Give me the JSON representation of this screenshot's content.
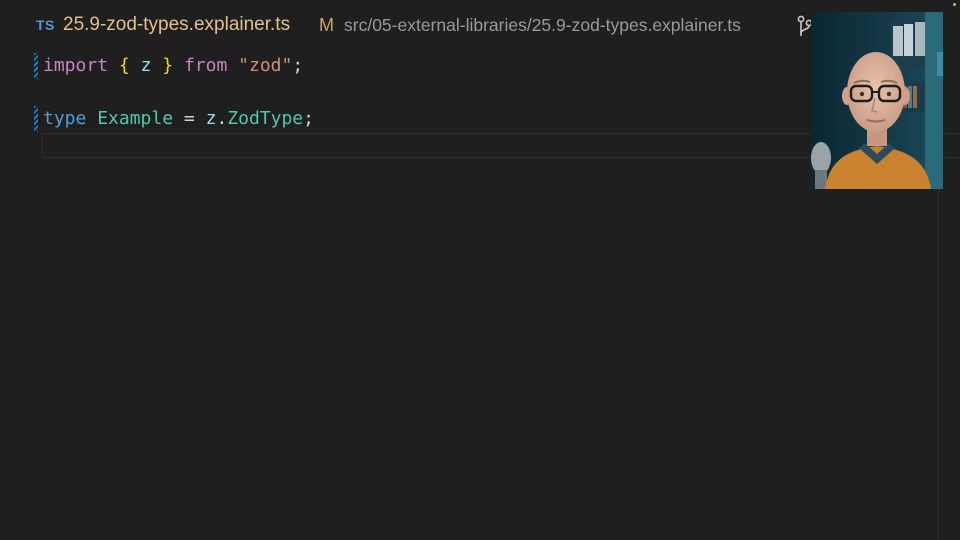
{
  "tab": {
    "language_badge": "TS",
    "file_name": "25.9-zod-types.explainer.ts",
    "status": "M",
    "file_path": "src/05-external-libraries/25.9-zod-types.explainer.ts"
  },
  "code": {
    "line1": {
      "kw": "import",
      "open_brace": "{",
      "ident": "z",
      "close_brace": "}",
      "from": "from",
      "module": "\"zod\"",
      "end": ";"
    },
    "line2": {
      "kw": "type",
      "name": "Example",
      "eq": "=",
      "ns": "z",
      "dot": ".",
      "type_ref": "ZodType",
      "end": ";"
    }
  },
  "colors": {
    "background": "#1f1f1f",
    "keyword_import": "#c586c0",
    "keyword_type": "#569cd6",
    "type_name": "#4ec9b0",
    "string": "#ce9178",
    "brace": "#ffd700",
    "file_name": "#e2c08d"
  },
  "icons": {
    "branch": "source-control-icon",
    "language": "typescript-icon"
  }
}
